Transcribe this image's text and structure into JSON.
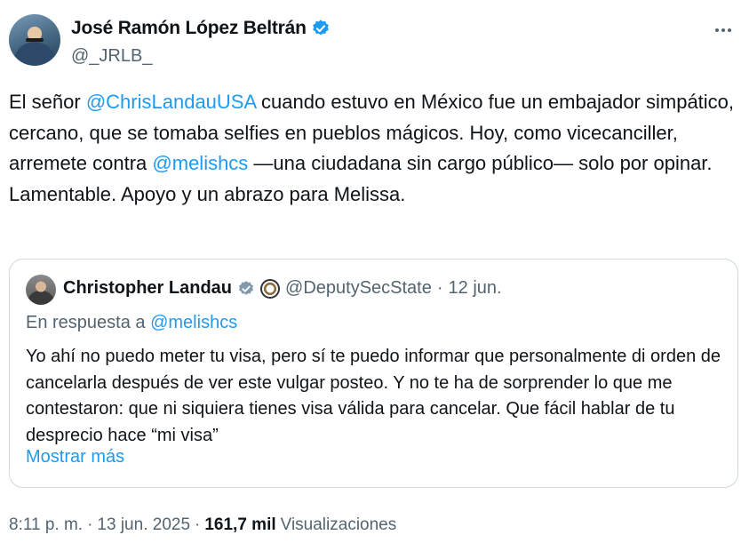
{
  "author": {
    "display_name": "José Ramón López Beltrán",
    "handle": "@_JRLB_",
    "verified": true
  },
  "tweet": {
    "parts": [
      {
        "text": "El señor ",
        "mention": false
      },
      {
        "text": "@ChrisLandauUSA",
        "mention": true
      },
      {
        "text": " cuando estuvo en México fue un embajador simpático, cercano, que se tomaba selfies en pueblos mágicos. Hoy, como vicecanciller, arremete contra ",
        "mention": false
      },
      {
        "text": "@melishcs",
        "mention": true
      },
      {
        "text": " —una ciudadana sin cargo público— solo por opinar. Lamentable. Apoyo y un abrazo para Melissa.",
        "mention": false
      }
    ]
  },
  "quote": {
    "display_name": "Christopher Landau",
    "handle": "@DeputySecState",
    "separator": "·",
    "date": "12 jun.",
    "reply_prefix": "En respuesta a ",
    "reply_mention": "@melishcs",
    "text": "Yo ahí no puedo meter tu visa, pero sí te puedo informar que personalmente di orden de cancelarla después de ver este vulgar posteo. Y no te ha de sorprender lo que me contestaron: que ni siquiera tienes visa válida para cancelar. Que fácil hablar de tu desprecio hace “mi visa”",
    "show_more": "Mostrar más"
  },
  "meta": {
    "time": "8:11 p. m.",
    "sep1": "·",
    "date": "13 jun. 2025",
    "sep2": "·",
    "views_count": "161,7 mil",
    "views_label": "Visualizaciones"
  },
  "colors": {
    "accent": "#1d9bf0",
    "text": "#0f1419",
    "secondary": "#536471",
    "border": "#cfd9de"
  },
  "icons": [
    "verified-badge-icon",
    "more-options-icon",
    "government-seal-icon"
  ]
}
